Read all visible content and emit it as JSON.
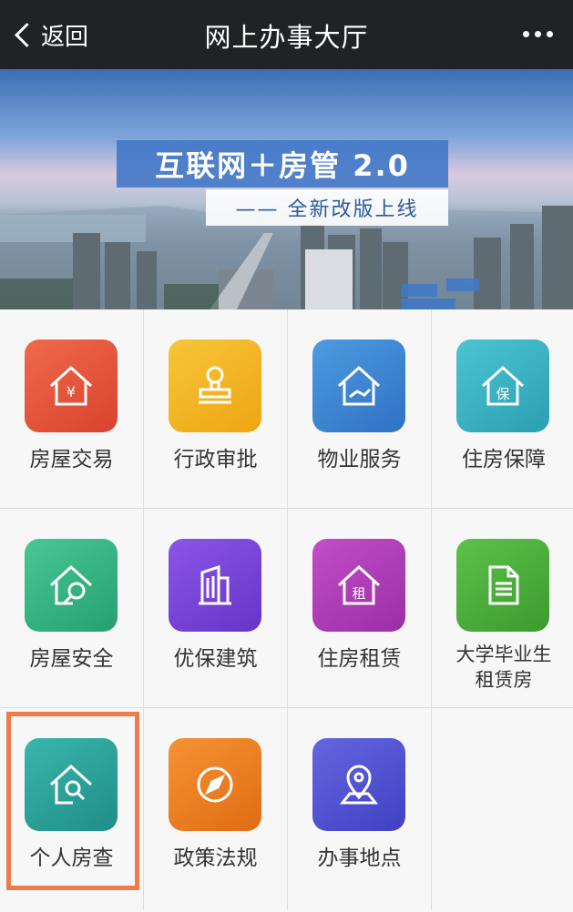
{
  "header": {
    "back_label": "返回",
    "title": "网上办事大厅"
  },
  "banner": {
    "headline": "互联网＋房管 2.0",
    "subline": "—— 全新改版上线"
  },
  "services": [
    {
      "label": "房屋交易",
      "icon": "house-yen-icon",
      "color": "#e4573c"
    },
    {
      "label": "行政审批",
      "icon": "stamp-icon",
      "color": "#f2b21d"
    },
    {
      "label": "物业服务",
      "icon": "house-handshake-icon",
      "color": "#3d86d3"
    },
    {
      "label": "住房保障",
      "icon": "house-protect-icon",
      "color": "#3bb3c3"
    },
    {
      "label": "房屋安全",
      "icon": "house-search-icon",
      "color": "#38b583"
    },
    {
      "label": "优保建筑",
      "icon": "building-icon",
      "color": "#7a45d8"
    },
    {
      "label": "住房租赁",
      "icon": "house-rent-icon",
      "color": "#b13fb9"
    },
    {
      "label": "大学毕业生\n租赁房",
      "icon": "document-icon",
      "color": "#4db23c"
    },
    {
      "label": "个人房查",
      "icon": "house-query-icon",
      "color": "#2ba39a"
    },
    {
      "label": "政策法规",
      "icon": "compass-icon",
      "color": "#f07d21"
    },
    {
      "label": "办事地点",
      "icon": "map-pin-icon",
      "color": "#5456d4"
    }
  ]
}
